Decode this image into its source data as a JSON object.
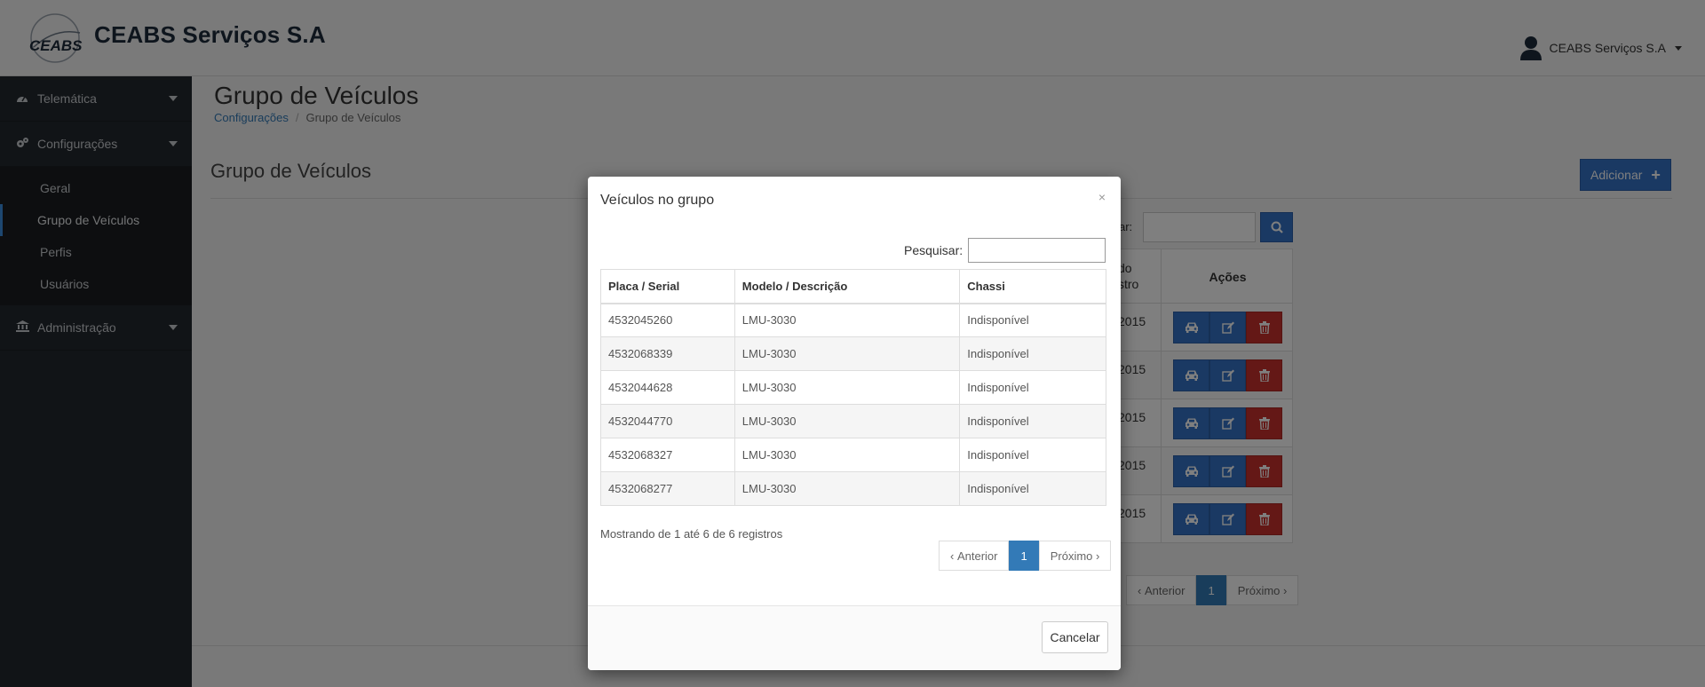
{
  "header": {
    "logo_text": "CEABS",
    "brand": "CEABS Serviços S.A",
    "user_name": "CEABS Serviços S.A"
  },
  "sidebar": {
    "items": [
      {
        "label": "Telemática",
        "icon": "dashboard-icon"
      },
      {
        "label": "Configurações",
        "icon": "gears-icon"
      },
      {
        "label": "Administração",
        "icon": "bank-icon"
      }
    ],
    "submenu": [
      {
        "label": "Geral"
      },
      {
        "label": "Grupo de Veículos",
        "active": true
      },
      {
        "label": "Perfis"
      },
      {
        "label": "Usuários"
      }
    ]
  },
  "page": {
    "title": "Grupo de Veículos",
    "breadcrumb": {
      "link": "Configurações",
      "separator": "/",
      "current": "Grupo de Veículos"
    },
    "panel_title": "Grupo de Veículos",
    "add_button": "Adicionar",
    "search_label_partial": "ar:",
    "table": {
      "date_header_partial_1": "do",
      "date_header_partial_2": "stro",
      "actions_header": "Ações",
      "rows": [
        {
          "year": "2015"
        },
        {
          "year": "2015"
        },
        {
          "year": "2015"
        },
        {
          "year": "2015"
        },
        {
          "year": "2015"
        }
      ]
    },
    "pagination": {
      "prev": "Anterior",
      "page": "1",
      "next": "Próximo"
    }
  },
  "modal": {
    "title": "Veículos no grupo",
    "close": "×",
    "search_label": "Pesquisar:",
    "search_value": "",
    "columns": [
      "Placa / Serial",
      "Modelo / Descrição",
      "Chassi"
    ],
    "rows": [
      [
        "4532045260",
        "LMU-3030",
        "Indisponível"
      ],
      [
        "4532068339",
        "LMU-3030",
        "Indisponível"
      ],
      [
        "4532044628",
        "LMU-3030",
        "Indisponível"
      ],
      [
        "4532044770",
        "LMU-3030",
        "Indisponível"
      ],
      [
        "4532068327",
        "LMU-3030",
        "Indisponível"
      ],
      [
        "4532068277",
        "LMU-3030",
        "Indisponível"
      ]
    ],
    "info": "Mostrando de 1 até 6 de 6 registros",
    "pagination": {
      "prev": "Anterior",
      "page": "1",
      "next": "Próximo"
    },
    "cancel": "Cancelar"
  },
  "colors": {
    "primary": "#3572c6",
    "danger": "#c9302c",
    "sidebar_bg": "#23282e",
    "link": "#337ab7"
  }
}
